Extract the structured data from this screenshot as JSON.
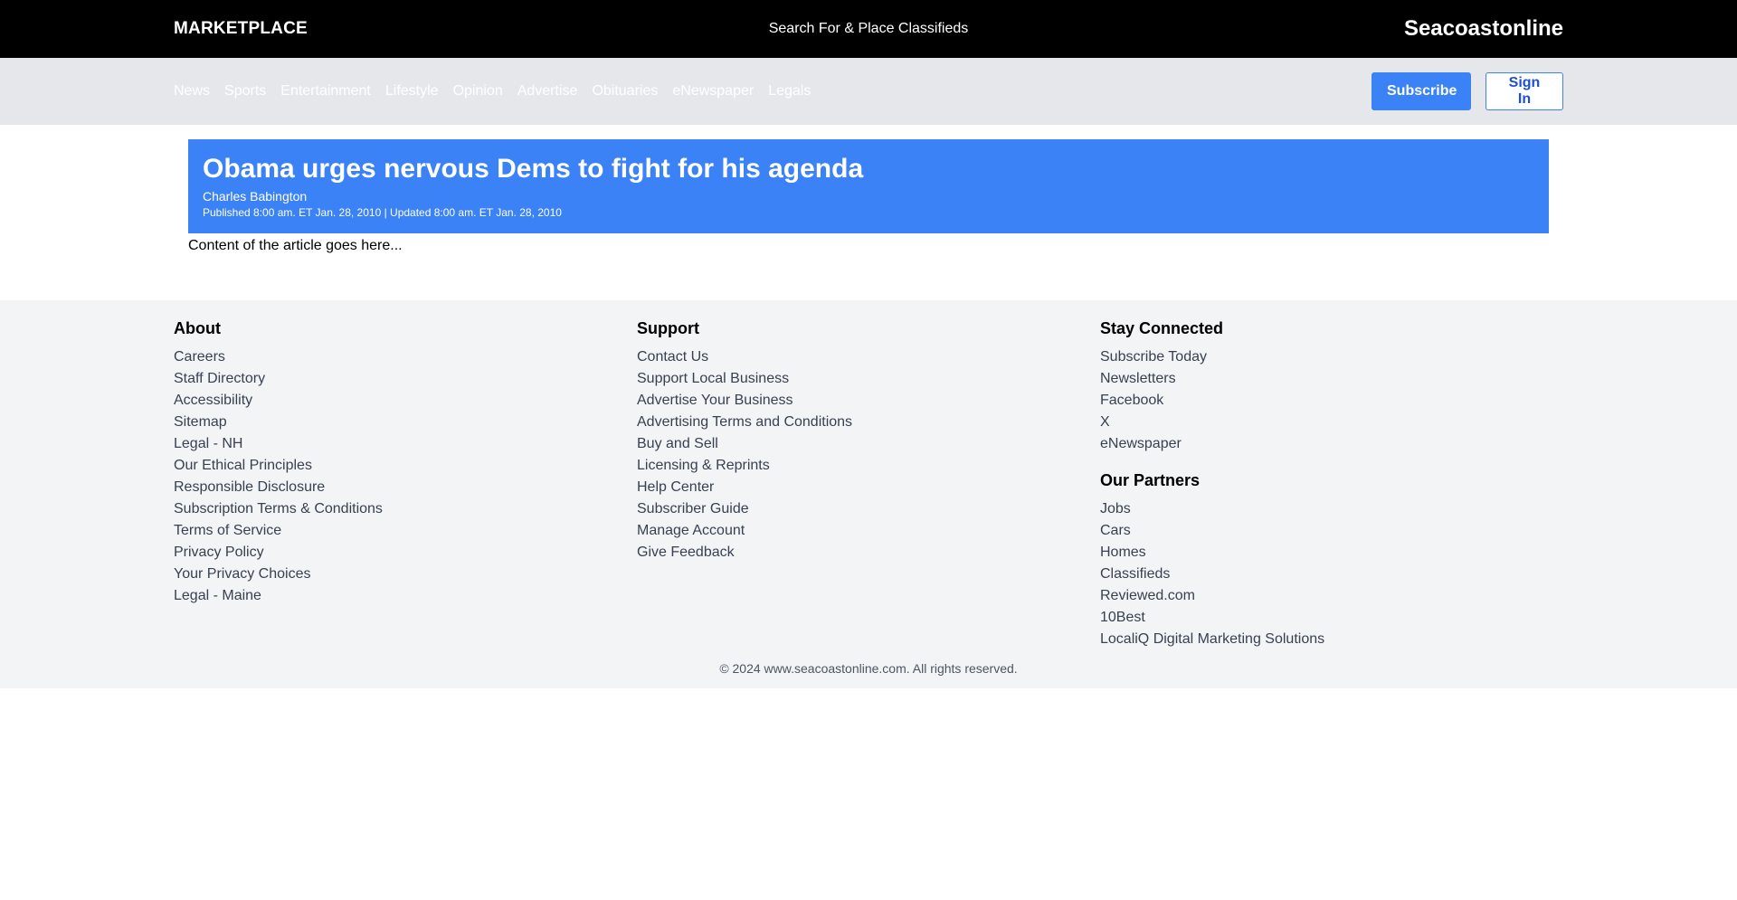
{
  "topbar": {
    "marketplace": "MARKETPLACE",
    "center_text": "Search For & Place Classifieds",
    "site_name": "Seacoastonline"
  },
  "nav": {
    "links": [
      "News",
      "Sports",
      "Entertainment",
      "Lifestyle",
      "Opinion",
      "Advertise",
      "Obituaries",
      "eNewspaper",
      "Legals"
    ],
    "subscribe_label": "Subscribe",
    "signin_label": "Sign In"
  },
  "article": {
    "title": "Obama urges nervous Dems to fight for his agenda",
    "author": "Charles Babington",
    "dateline": "Published 8:00 am. ET Jan. 28, 2010 | Updated 8:00 am. ET Jan. 28, 2010",
    "body": "Content of the article goes here..."
  },
  "footer": {
    "about": {
      "heading": "About",
      "items": [
        "Careers",
        "Staff Directory",
        "Accessibility",
        "Sitemap",
        "Legal - NH",
        "Our Ethical Principles",
        "Responsible Disclosure",
        "Subscription Terms & Conditions",
        "Terms of Service",
        "Privacy Policy",
        "Your Privacy Choices",
        "Legal - Maine"
      ]
    },
    "support": {
      "heading": "Support",
      "items": [
        "Contact Us",
        "Support Local Business",
        "Advertise Your Business",
        "Advertising Terms and Conditions",
        "Buy and Sell",
        "Licensing & Reprints",
        "Help Center",
        "Subscriber Guide",
        "Manage Account",
        "Give Feedback"
      ]
    },
    "stay_connected": {
      "heading": "Stay Connected",
      "items": [
        "Subscribe Today",
        "Newsletters",
        "Facebook",
        "X",
        "eNewspaper"
      ]
    },
    "partners": {
      "heading": "Our Partners",
      "items": [
        "Jobs",
        "Cars",
        "Homes",
        "Classifieds",
        "Reviewed.com",
        "10Best",
        "LocaliQ Digital Marketing Solutions"
      ]
    },
    "copyright": "© 2024 www.seacoastonline.com. All rights reserved."
  },
  "colors": {
    "topbar_bg": "#000000",
    "navbar_bg": "#e5e7eb",
    "accent": "#3b82f6",
    "footer_bg": "#f3f4f6"
  }
}
